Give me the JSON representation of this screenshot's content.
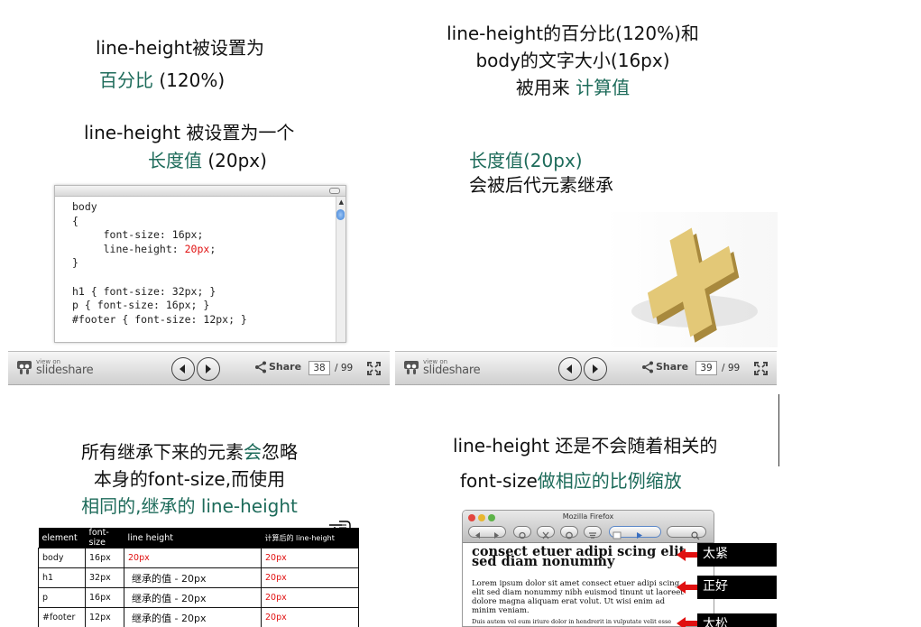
{
  "slide37": {
    "line1": "line-height被设置为",
    "line2_green": "百分比",
    "line2_rest": " (120%)"
  },
  "slide37_right": {
    "line1": "line-height的百分比(120%)和",
    "line2": "body的文字大小(16px)",
    "line3_black": "被用来 ",
    "line3_green": "计算值"
  },
  "slide38": {
    "line1": "line-height 被设置为一个",
    "line2_green": "长度值",
    "line2_rest": " (20px)",
    "code_pre": "body\n{\n     font-size: 16px;\n     line-height: ",
    "code_red": "20px",
    "code_post": ";\n}\n\nh1 { font-size: 32px; }\np { font-size: 16px; }\n#footer { font-size: 12px; }"
  },
  "slide39": {
    "line1_green": "长度值(20px)",
    "line2": "会被后代元素继承"
  },
  "player_left": {
    "view_on": "view on",
    "brand": "slideshare",
    "share": "Share",
    "page": "38",
    "total": "/ 99"
  },
  "player_right": {
    "view_on": "view on",
    "brand": "slideshare",
    "share": "Share",
    "page": "39",
    "total": "/ 99"
  },
  "slide40": {
    "line1a": "所有继承下来的元素",
    "line1_green": "会",
    "line1b": "忽略",
    "line2": "本身的font-size,而使用",
    "line3_green": "相同的,继承的 line-height",
    "table": {
      "headers": [
        "element",
        "font-size",
        "line height",
        "计算后的 line-height"
      ],
      "rows": [
        [
          "body",
          "16px",
          "20px",
          "20px"
        ],
        [
          "h1",
          "32px",
          "继承的值 - 20px",
          "20px"
        ],
        [
          "p",
          "16px",
          "继承的值 - 20px",
          "20px"
        ],
        [
          "#footer",
          "12px",
          "继承的值 - 20px",
          "20px"
        ]
      ]
    }
  },
  "slide41": {
    "line1": "line-height 还是不会随着相关的",
    "line2a": "font-size",
    "line2_green": "做相应的比例缩放",
    "browser_title": "Mozilla Firefox",
    "heading": "consect etuer adipi scing elit sed diam nonummy",
    "para": "Lorem ipsum dolor sit amet consect etuer adipi scing elit sed diam nonummy nibh euismod tinunt ut laoreet dolore magna aliquam erat volut. Ut wisi enim ad minim veniam.",
    "footer_text": "Duis autem vel eum iriure dolor in hendrerit in vulputate velit esse molestie",
    "tag1": "太紧",
    "tag2": "正好",
    "tag3": "太松"
  },
  "colors": {
    "accent_green": "#1d6b5a",
    "highlight_red": "#e01010"
  }
}
